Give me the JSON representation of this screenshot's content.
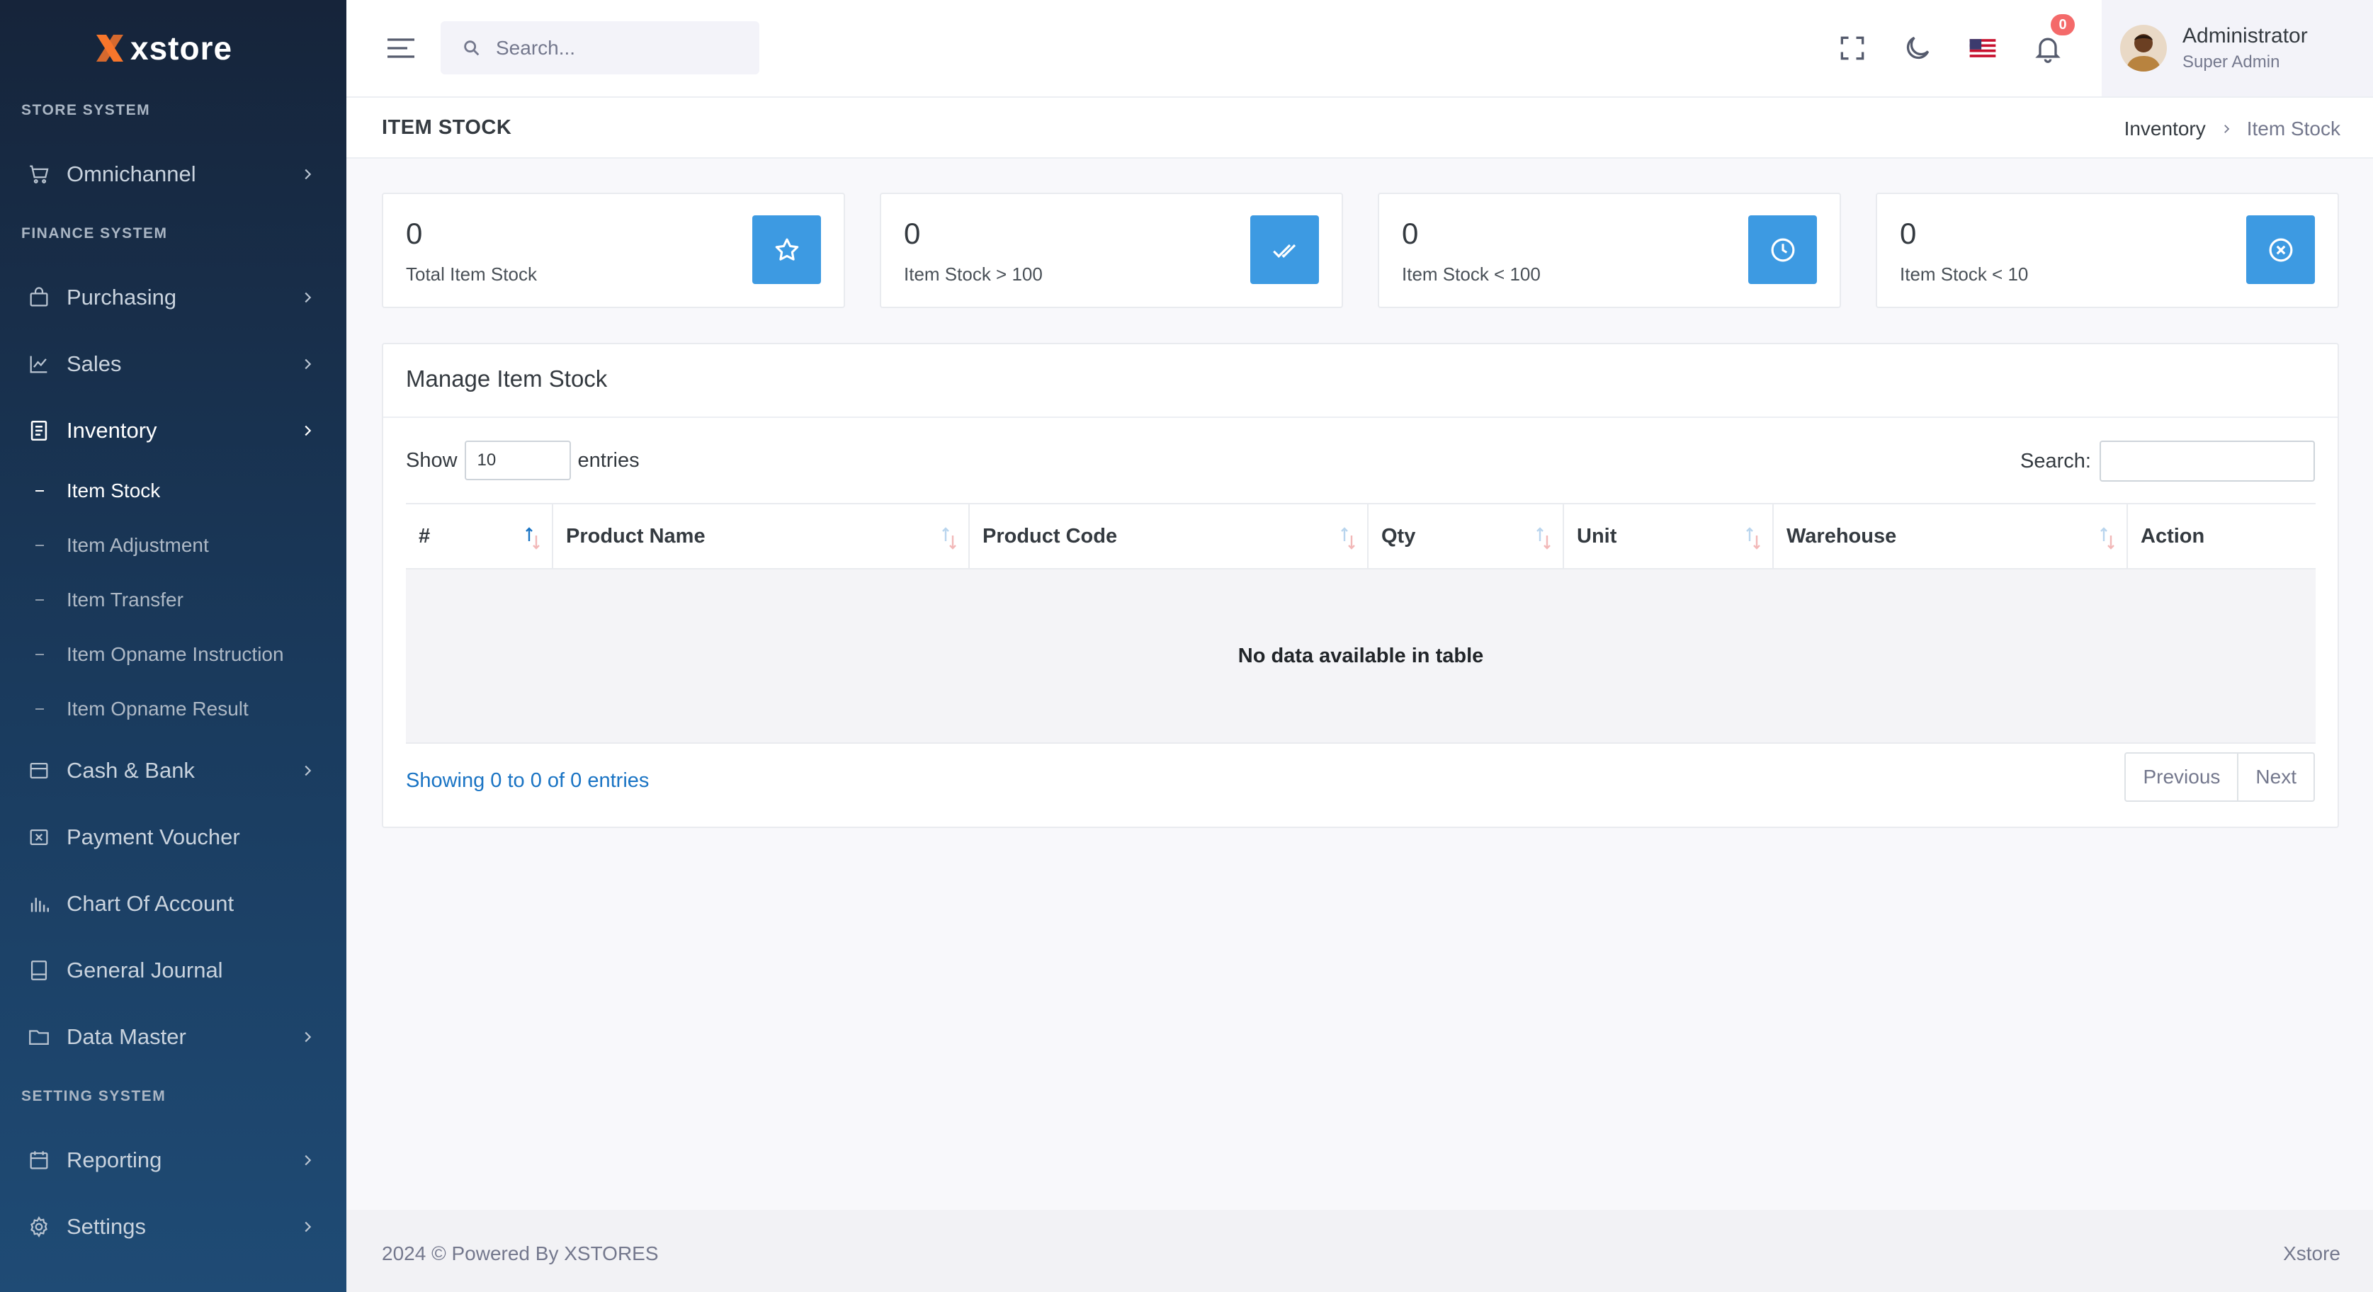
{
  "brand": {
    "name": "xstore",
    "accent": "#f7762b"
  },
  "sidebar": {
    "sections": {
      "store": "STORE SYSTEM",
      "finance": "FINANCE SYSTEM",
      "setting": "SETTING SYSTEM"
    },
    "items": {
      "omnichannel": {
        "label": "Omnichannel",
        "icon": "cart-icon"
      },
      "purchasing": {
        "label": "Purchasing",
        "icon": "bag-icon"
      },
      "sales": {
        "label": "Sales",
        "icon": "line-chart-icon"
      },
      "inventory": {
        "label": "Inventory",
        "icon": "document-icon"
      },
      "cash_bank": {
        "label": "Cash & Bank",
        "icon": "wallet-icon"
      },
      "payment_voucher": {
        "label": "Payment Voucher",
        "icon": "voucher-icon"
      },
      "chart_of_account": {
        "label": "Chart Of Account",
        "icon": "bar-chart-icon"
      },
      "general_journal": {
        "label": "General Journal",
        "icon": "journal-icon"
      },
      "data_master": {
        "label": "Data Master",
        "icon": "folder-icon"
      },
      "reporting": {
        "label": "Reporting",
        "icon": "calendar-icon"
      },
      "settings": {
        "label": "Settings",
        "icon": "gear-icon"
      }
    },
    "inventory_sub": {
      "item_stock": "Item Stock",
      "item_adjustment": "Item Adjustment",
      "item_transfer": "Item Transfer",
      "item_opname_instruction": "Item Opname Instruction",
      "item_opname_result": "Item Opname Result"
    }
  },
  "topbar": {
    "search_placeholder": "Search...",
    "notification_count": "0",
    "user": {
      "name": "Administrator",
      "role": "Super Admin"
    }
  },
  "page": {
    "title": "ITEM STOCK",
    "breadcrumb": {
      "parent": "Inventory",
      "current": "Item Stock"
    }
  },
  "stats": [
    {
      "value": "0",
      "label": "Total Item Stock",
      "icon": "star-icon"
    },
    {
      "value": "0",
      "label": "Item Stock > 100",
      "icon": "double-check-icon"
    },
    {
      "value": "0",
      "label": "Item Stock < 100",
      "icon": "clock-icon"
    },
    {
      "value": "0",
      "label": "Item Stock < 10",
      "icon": "close-circle-icon"
    }
  ],
  "table": {
    "title": "Manage Item Stock",
    "show_label": "Show",
    "entries_label": "entries",
    "page_length": "10",
    "search_label": "Search:",
    "columns": [
      "#",
      "Product Name",
      "Product Code",
      "Qty",
      "Unit",
      "Warehouse",
      "Action"
    ],
    "empty_text": "No data available in table",
    "info": "Showing 0 to 0 of 0 entries",
    "prev_label": "Previous",
    "next_label": "Next"
  },
  "footer": {
    "left": "2024 © Powered By XSTORES",
    "right": "Xstore"
  },
  "colors": {
    "primary": "#3d9ae2",
    "badge": "#f46a6a",
    "link": "#1a74c4"
  }
}
